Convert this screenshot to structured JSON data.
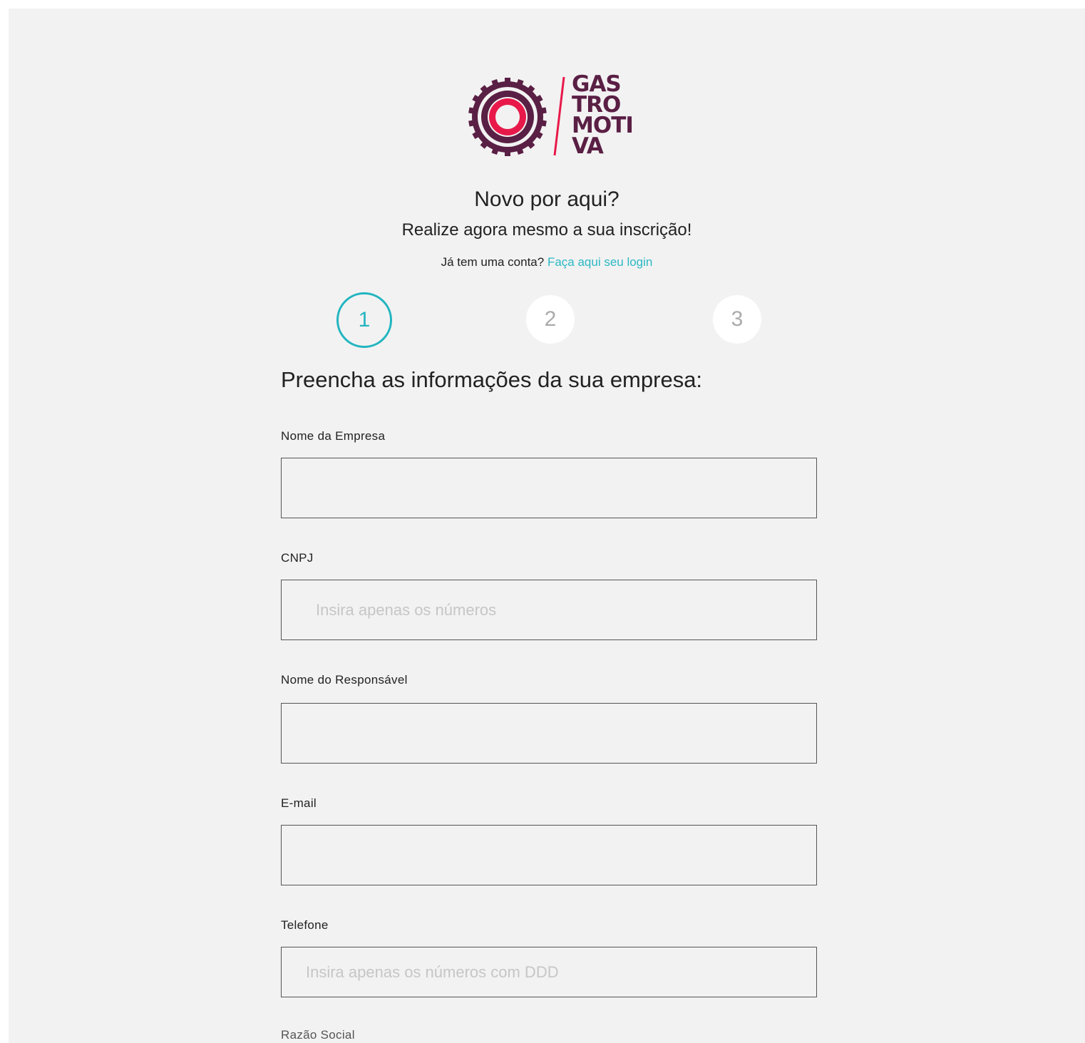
{
  "brand": {
    "logo_lines": [
      "GAS",
      "TRO",
      "MOTI",
      "VA"
    ],
    "colors": {
      "ring": "#5a1f44",
      "accent": "#e8194a"
    }
  },
  "header": {
    "title": "Novo por aqui?",
    "subtitle": "Realize agora mesmo a sua inscrição!",
    "login_prompt": "Já tem uma conta?",
    "login_link": "Faça aqui seu login"
  },
  "steps": [
    {
      "label": "1",
      "active": true
    },
    {
      "label": "2",
      "active": false
    },
    {
      "label": "3",
      "active": false
    }
  ],
  "form": {
    "section_title": "Preencha as informações da sua empresa:",
    "fields": [
      {
        "label": "Nome da Empresa",
        "placeholder": ""
      },
      {
        "label": "CNPJ",
        "placeholder": "Insira apenas os números"
      },
      {
        "label": "Nome do Responsável",
        "placeholder": ""
      },
      {
        "label": "E-mail",
        "placeholder": ""
      },
      {
        "label": "Telefone",
        "placeholder": "Insira apenas os números com DDD"
      },
      {
        "label": "Razão Social",
        "placeholder": ""
      }
    ]
  },
  "theme": {
    "accent": "#22b5c0",
    "background": "#f2f2f2"
  }
}
